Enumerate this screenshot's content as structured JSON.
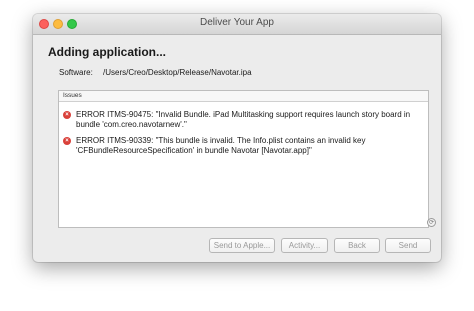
{
  "window": {
    "title": "Deliver Your App"
  },
  "main": {
    "heading": "Adding application...",
    "software_label": "Software:",
    "software_path": "/Users/Creo/Desktop/Release/Navotar.ipa"
  },
  "issues": {
    "header": "Issues",
    "items": [
      {
        "icon": "error-icon",
        "line1": "ERROR ITMS-90475: \"Invalid Bundle. iPad Multitasking support requires launch story board in",
        "line2": "bundle 'com.creo.navotarnew'.\""
      },
      {
        "icon": "error-icon",
        "line1": "ERROR ITMS-90339: \"This bundle is invalid. The Info.plist contains an invalid key",
        "line2": "'CFBundleResourceSpecification' in bundle Navotar [Navotar.app]\""
      }
    ]
  },
  "buttons": {
    "send_to_apple": "Send to Apple...",
    "activity": "Activity...",
    "back": "Back",
    "send": "Send"
  },
  "colors": {
    "error_red": "#d9403a",
    "window_bg": "#ececec"
  }
}
